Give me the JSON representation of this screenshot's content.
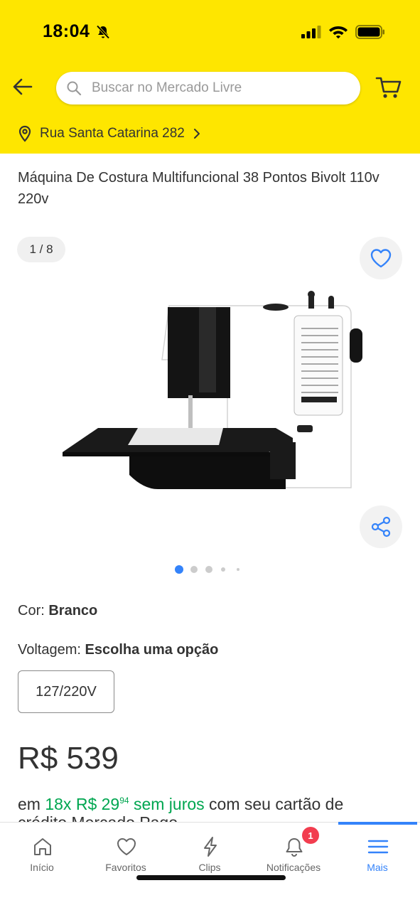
{
  "status_bar": {
    "time": "18:04"
  },
  "header": {
    "back_icon": "arrow-left-icon",
    "search": {
      "placeholder": "Buscar no Mercado Livre",
      "value": ""
    },
    "cart_icon": "cart-icon",
    "address": "Rua Santa Catarina 282"
  },
  "product": {
    "title": "Máquina De Costura Multifuncional 38 Pontos Bivolt 110v 220v",
    "image_counter": "1 / 8",
    "image_dots_active": 1,
    "color_label": "Cor:",
    "color_value": "Branco",
    "voltage_label": "Voltagem:",
    "voltage_value": "Escolha uma opção",
    "voltage_options": [
      "127/220V"
    ],
    "price": "R$ 539",
    "installments": {
      "prefix": "em",
      "count": "18x",
      "amount": "R$ 29",
      "cents": "94",
      "interest": "sem juros",
      "suffix": "com seu cartão de",
      "line2": "crédito Mercado Pago"
    }
  },
  "bottom_nav": {
    "items": [
      {
        "label": "Início",
        "icon": "home-icon"
      },
      {
        "label": "Favoritos",
        "icon": "heart-icon"
      },
      {
        "label": "Clips",
        "icon": "clips-icon"
      },
      {
        "label": "Notificações",
        "icon": "bell-icon",
        "badge": "1"
      },
      {
        "label": "Mais",
        "icon": "menu-icon",
        "active": true
      }
    ]
  },
  "colors": {
    "header_bg": "#fee600",
    "accent": "#3483fa",
    "green": "#00a650",
    "badge_red": "#f23d4f"
  }
}
